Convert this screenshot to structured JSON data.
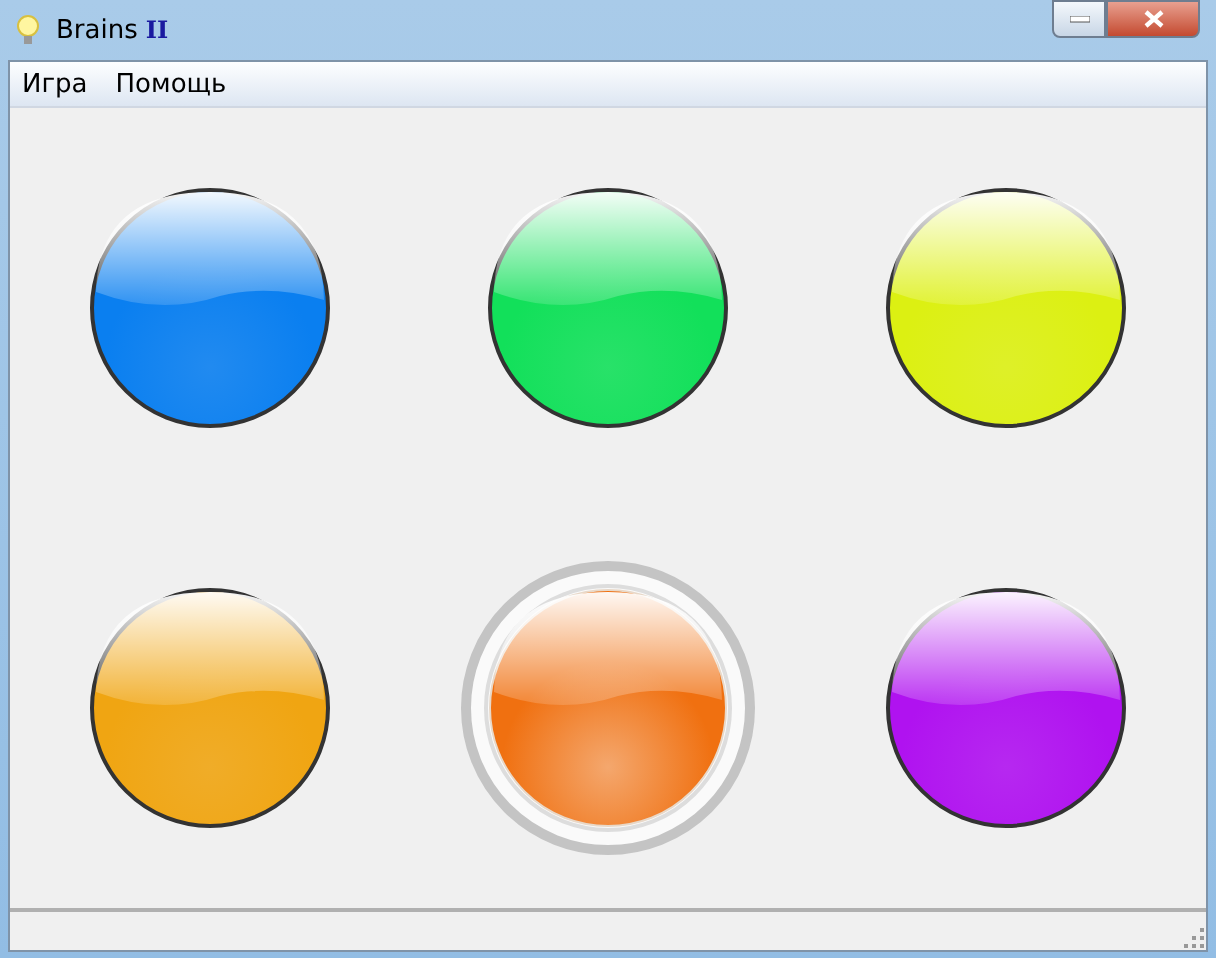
{
  "window": {
    "title": "Brains",
    "version": "II"
  },
  "menu": [
    "Игра",
    "Помощь"
  ],
  "buttons": [
    {
      "color": "#0a7ff0",
      "selected": false
    },
    {
      "color": "#12e05a",
      "selected": false
    },
    {
      "color": "#dcf012",
      "selected": false
    },
    {
      "color": "#f0a512",
      "selected": false
    },
    {
      "color": "#f07010",
      "selected": true
    },
    {
      "color": "#b012f0",
      "selected": false
    }
  ]
}
